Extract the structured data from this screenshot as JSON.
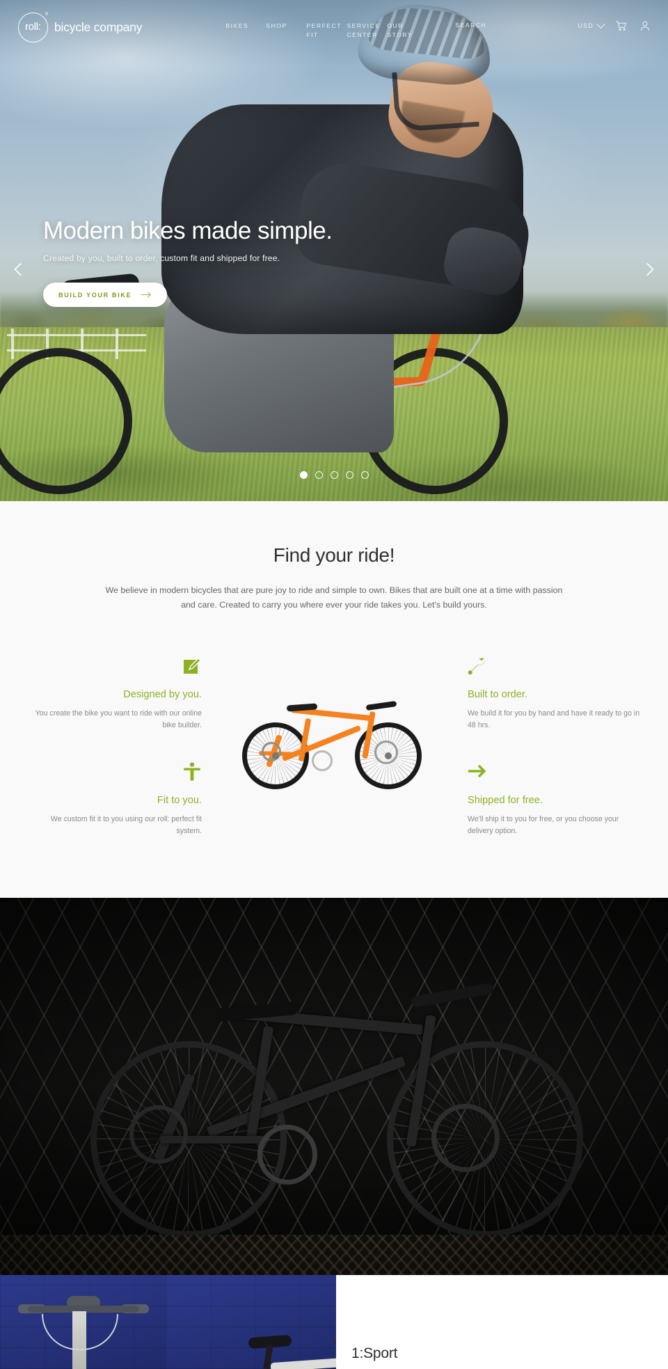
{
  "header": {
    "brand_mark_text": "roll:",
    "brand_mark_reg": "®",
    "brand_name": "bicycle company",
    "nav": [
      {
        "label": "BIKES"
      },
      {
        "label": "SHOP"
      },
      {
        "label": "PERFECT FIT"
      },
      {
        "label": "SERVICE CENTER"
      },
      {
        "label": "OUR STORY"
      }
    ],
    "search_label": "SEARCH",
    "currency": "USD",
    "cart_icon": "cart-icon",
    "account_icon": "user-icon",
    "chevron_icon": "chevron-down-icon"
  },
  "hero": {
    "headline": "Modern bikes made simple.",
    "subhead": "Created by you, built to order, custom fit and shipped for free.",
    "cta_label": "BUILD YOUR BIKE",
    "cta_icon": "arrow-right-icon",
    "prev_icon": "chevron-left-icon",
    "next_icon": "chevron-right-icon",
    "slide_count": 5,
    "active_slide": 1
  },
  "ride": {
    "title": "Find your ride!",
    "lead": "We believe in modern bicycles that are pure joy to ride and simple to own. Bikes that are built one at a time with passion and care. Created to carry you where ever your ride takes you. Let's build yours.",
    "features": [
      {
        "icon": "pencil-square-icon",
        "title": "Designed by you.",
        "text": "You create the bike you want to ride with our online bike builder."
      },
      {
        "icon": "wrench-icon",
        "title": "Built to order.",
        "text": "We build it for you by hand and have it ready to go in 48 hrs."
      },
      {
        "icon": "person-icon",
        "title": "Fit to you.",
        "text": "We custom fit it to you using our roll: perfect fit system."
      },
      {
        "icon": "arrow-right-icon",
        "title": "Shipped for free.",
        "text": "We'll ship it to you for free, or you choose your delivery option."
      }
    ],
    "bike_image_alt": "orange-bicycle"
  },
  "dark_section": {
    "image_alt": "black-bicycle-against-gate"
  },
  "product": {
    "name": "1:Sport",
    "tile_1_alt": "handlebar-detail",
    "tile_2_alt": "saddle-detail"
  },
  "colors": {
    "accent_green": "#8cb224",
    "cta_green": "#7f9a13",
    "bike_orange": "#f58220",
    "section_bg": "#f9f9f9",
    "blue_tile": "#2d3a8c"
  }
}
